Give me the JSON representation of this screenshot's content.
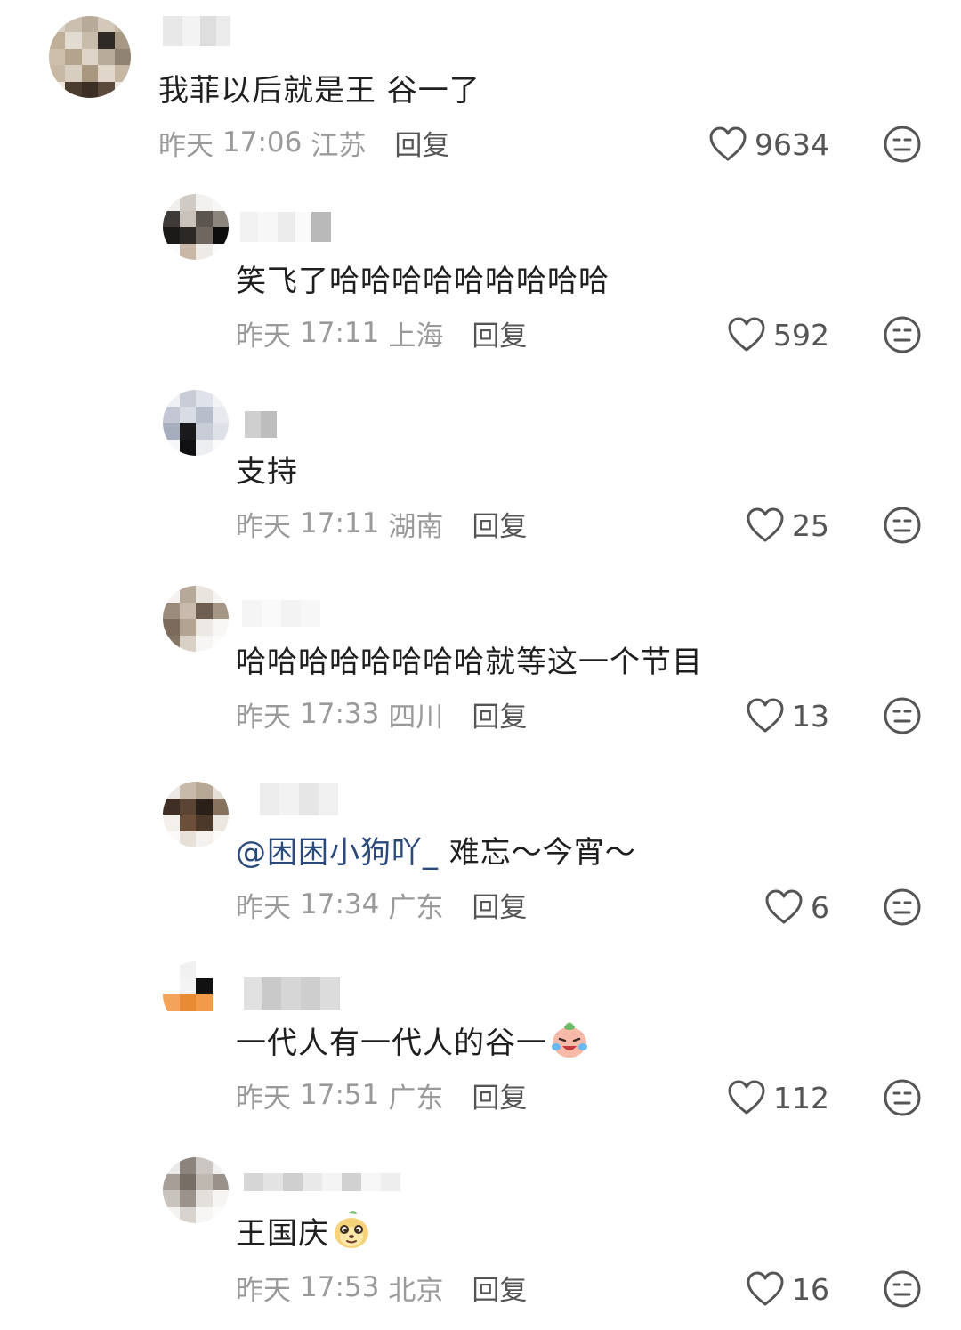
{
  "comments": [
    {
      "text": "我菲以后就是王 谷一了",
      "date": "昨天",
      "time": "17:06",
      "region": "江苏",
      "reply": "回复",
      "likes": "9634"
    },
    {
      "text": "笑飞了哈哈哈哈哈哈哈哈哈",
      "date": "昨天",
      "time": "17:11",
      "region": "上海",
      "reply": "回复",
      "likes": "592"
    },
    {
      "text": "支持",
      "date": "昨天",
      "time": "17:11",
      "region": "湖南",
      "reply": "回复",
      "likes": "25"
    },
    {
      "text": "哈哈哈哈哈哈哈哈就等这一个节目",
      "date": "昨天",
      "time": "17:33",
      "region": "四川",
      "reply": "回复",
      "likes": "13"
    },
    {
      "mention": "@困困小狗吖_",
      "text": " 难忘～今宵～",
      "date": "昨天",
      "time": "17:34",
      "region": "广东",
      "reply": "回复",
      "likes": "6"
    },
    {
      "text": "一代人有一代人的谷一",
      "emoji": "crying-laughing-face-icon",
      "date": "昨天",
      "time": "17:51",
      "region": "广东",
      "reply": "回复",
      "likes": "112"
    },
    {
      "text": "王国庆",
      "emoji": "smug-face-icon",
      "date": "昨天",
      "time": "17:53",
      "region": "北京",
      "reply": "回复",
      "likes": "16"
    }
  ],
  "icons": {
    "like": "heart-outline-icon",
    "dislike": "neutral-face-icon"
  },
  "colors": {
    "text": "#1f1f1f",
    "meta": "#9a9a9a",
    "mention": "#2b4a7c",
    "icon": "#555555"
  }
}
